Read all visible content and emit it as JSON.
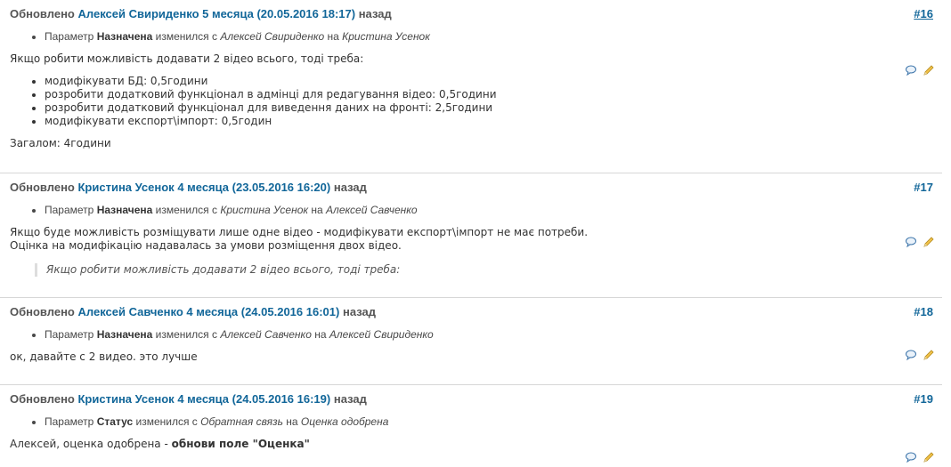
{
  "entries": [
    {
      "prefix": "Обновлено",
      "author": "Алексей Свириденко",
      "age": "5 месяца (20.05.2016 18:17)",
      "suffix": "назад",
      "num": "#16",
      "detail": {
        "pre": "Параметр",
        "field": "Назначена",
        "mid": "изменился с",
        "old": "Алексей Свириденко",
        "on": "на",
        "new": "Кристина Усенок"
      },
      "note_intro": "Якщо робити можливість додавати 2 відео всього, тоді треба:",
      "note_items": [
        "модифікувати БД: 0,5години",
        "розробити додатковий функціонал в адмінці для редагування відео: 0,5години",
        "розробити додатковий функціонал для виведення даних на фронті: 2,5години",
        "модифікувати експорт\\імпорт: 0,5годин"
      ],
      "note_total": "Загалом: 4години"
    },
    {
      "prefix": "Обновлено",
      "author": "Кристина Усенок",
      "age": "4 месяца (23.05.2016 16:20)",
      "suffix": "назад",
      "num": "#17",
      "detail": {
        "pre": "Параметр",
        "field": "Назначена",
        "mid": "изменился с",
        "old": "Кристина Усенок",
        "on": "на",
        "new": "Алексей Савченко"
      },
      "note_line1": "Якщо буде можливість розміщувати лише одне відео - модифікувати експорт\\імпорт не має потреби.",
      "note_line2": "Оцінка на модифікацію надавалась за умови розміщення двох відео.",
      "quote": "Якщо робити можливість додавати 2 відео всього, тоді треба:"
    },
    {
      "prefix": "Обновлено",
      "author": "Алексей Савченко",
      "age": "4 месяца (24.05.2016 16:01)",
      "suffix": "назад",
      "num": "#18",
      "detail": {
        "pre": "Параметр",
        "field": "Назначена",
        "mid": "изменился с",
        "old": "Алексей Савченко",
        "on": "на",
        "new": "Алексей Свириденко"
      },
      "note_line1": "ок, давайте с 2 видео. это лучше"
    },
    {
      "prefix": "Обновлено",
      "author": "Кристина Усенок",
      "age": "4 месяца (24.05.2016 16:19)",
      "suffix": "назад",
      "num": "#19",
      "detail": {
        "pre": "Параметр",
        "field": "Статус",
        "mid": "изменился с",
        "old": "Обратная связь",
        "on": "на",
        "new": "Оценка одобрена"
      },
      "note_pre": "Алексей, оценка одобрена -",
      "note_bold": "обнови поле \"Оценка\""
    }
  ],
  "icons": {
    "quote": "comment-icon",
    "edit": "pencil-icon"
  }
}
